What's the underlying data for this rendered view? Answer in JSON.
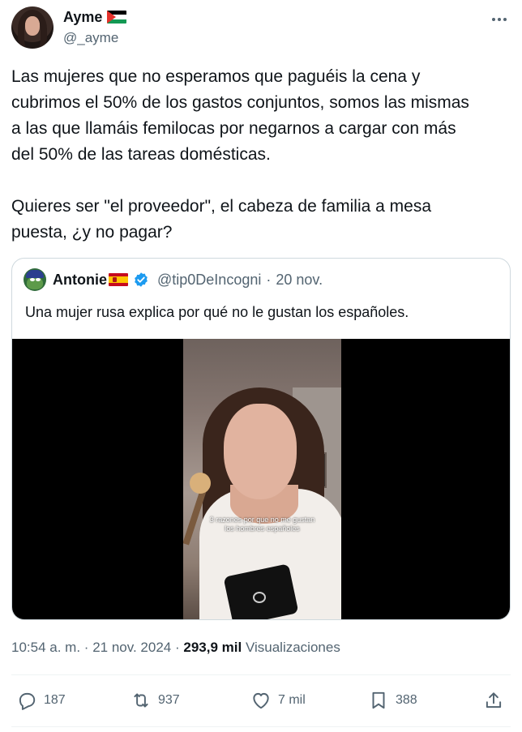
{
  "author": {
    "display_name": "Ayme",
    "handle": "@_ayme",
    "flag": "palestine-flag"
  },
  "tweet": {
    "text": "Las mujeres que no esperamos que paguéis la cena y\ncubrimos el 50% de los gastos conjuntos, somos las mismas\na las que llamáis femilocas por negarnos a cargar con más\ndel 50% de las tareas domésticas.\n\nQuieres ser \"el proveedor\", el cabeza de familia a mesa\npuesta, ¿y no pagar?"
  },
  "quote": {
    "display_name": "Antonie",
    "flag": "spain-flag",
    "verified": true,
    "handle": "@tip0DeIncogni",
    "separator": "·",
    "date": "20 nov.",
    "text": "Una mujer rusa explica por qué no le gustan los españoles.",
    "video_caption": "3 razones por que no me gustan\nlos hombres españoles"
  },
  "meta": {
    "time": "10:54 a. m.",
    "separator": "·",
    "date": "21 nov. 2024",
    "separator2": "·",
    "views_count": "293,9 mil",
    "views_label": "Visualizaciones"
  },
  "actions": {
    "replies": "187",
    "reposts": "937",
    "likes": "7 mil",
    "bookmarks": "388"
  },
  "colors": {
    "text": "#0f1419",
    "secondary": "#536471",
    "border": "#cfd9de",
    "verified": "#1d9bf0"
  }
}
